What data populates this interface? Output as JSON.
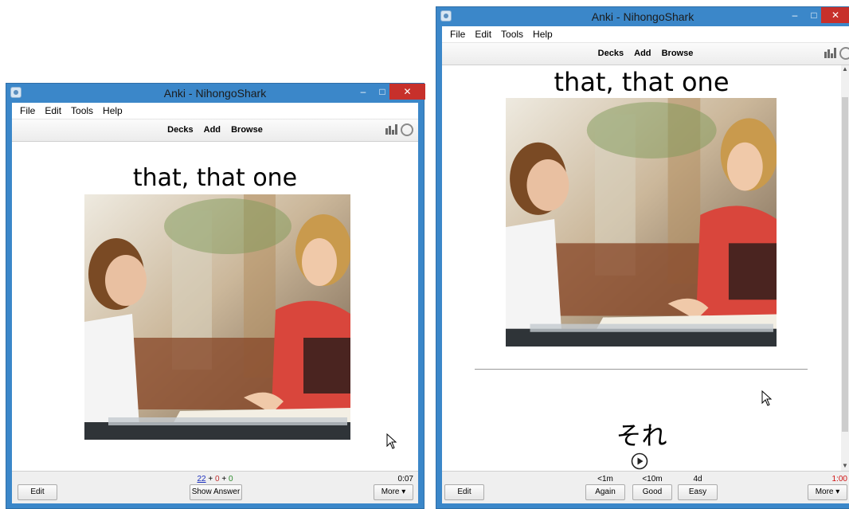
{
  "left_window": {
    "title": "Anki - NihongoShark",
    "menu": [
      "File",
      "Edit",
      "Tools",
      "Help"
    ],
    "toolbar": {
      "links": [
        "Decks",
        "Add",
        "Browse"
      ]
    },
    "question_text": "that, that one",
    "counts": {
      "new": "22",
      "sep1": "+",
      "learn": "0",
      "sep2": "+",
      "review": "0"
    },
    "timer": "0:07",
    "edit_label": "Edit",
    "show_answer_label": "Show Answer",
    "more_label": "More ▾"
  },
  "right_window": {
    "title": "Anki - NihongoShark",
    "menu": [
      "File",
      "Edit",
      "Tools",
      "Help"
    ],
    "toolbar": {
      "links": [
        "Decks",
        "Add",
        "Browse"
      ]
    },
    "question_text": "that, that one",
    "answer_text": "それ",
    "intervals": [
      "<1m",
      "<10m",
      "4d"
    ],
    "answer_buttons": [
      "Again",
      "Good",
      "Easy"
    ],
    "timer": "1:00",
    "edit_label": "Edit",
    "more_label": "More ▾"
  },
  "colors": {
    "frame_blue": "#3b87c9",
    "close_red": "#c7302b",
    "new_count": "#1a2ebd",
    "learn_count": "#c03030",
    "review_count": "#2a8a2a",
    "timer_red": "#d01010"
  },
  "icons": [
    "anki-app-icon",
    "minimize-icon",
    "maximize-icon",
    "close-icon",
    "stats-icon",
    "sync-icon",
    "play-audio-icon",
    "mouse-cursor-icon"
  ]
}
